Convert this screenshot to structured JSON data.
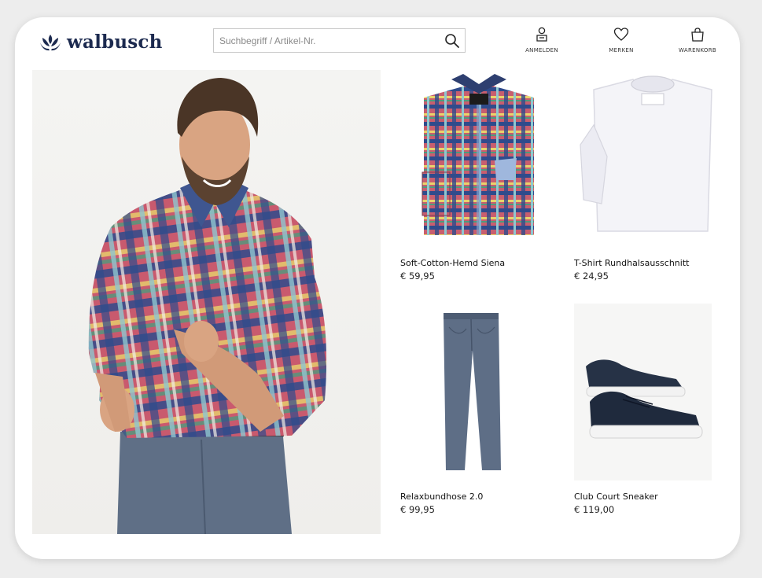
{
  "header": {
    "logo_text": "walbusch",
    "search": {
      "placeholder": "Suchbegriff / Artikel-Nr.",
      "value": ""
    },
    "nav": [
      {
        "label": "ANMELDEN",
        "icon": "user-icon"
      },
      {
        "label": "MERKEN",
        "icon": "heart-icon"
      },
      {
        "label": "WARENKORB",
        "icon": "shopping-bag-icon"
      }
    ]
  },
  "hero": {
    "icon": "model-photo-plaid-shirt"
  },
  "products": [
    {
      "name": "Soft-Cotton-Hemd Siena",
      "price": "€ 59,95",
      "image": "plaid-shirt-folded"
    },
    {
      "name": "T-Shirt Rundhalsausschnitt",
      "price": "€ 24,95",
      "image": "white-tshirt-folded"
    },
    {
      "name": "Relaxbundhose 2.0",
      "price": "€ 99,95",
      "image": "grey-blue-trousers"
    },
    {
      "name": "Club Court Sneaker",
      "price": "€ 119,00",
      "image": "navy-leather-sneakers"
    }
  ],
  "colors": {
    "brand": "#1c2a4f",
    "background": "#ededed",
    "card": "#ffffff"
  }
}
